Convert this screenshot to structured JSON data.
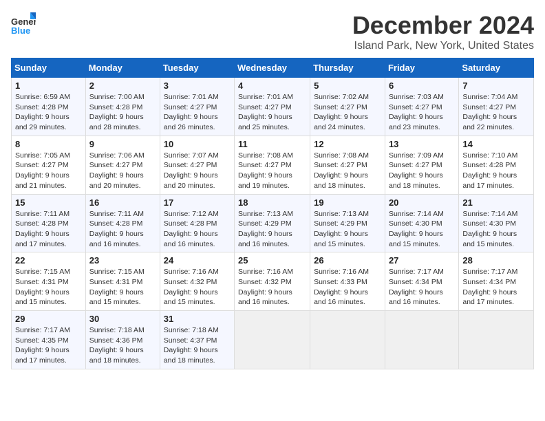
{
  "logo": {
    "line1": "General",
    "line2": "Blue"
  },
  "title": "December 2024",
  "subtitle": "Island Park, New York, United States",
  "days_of_week": [
    "Sunday",
    "Monday",
    "Tuesday",
    "Wednesday",
    "Thursday",
    "Friday",
    "Saturday"
  ],
  "weeks": [
    [
      {
        "day": 1,
        "info": "Sunrise: 6:59 AM\nSunset: 4:28 PM\nDaylight: 9 hours\nand 29 minutes."
      },
      {
        "day": 2,
        "info": "Sunrise: 7:00 AM\nSunset: 4:28 PM\nDaylight: 9 hours\nand 28 minutes."
      },
      {
        "day": 3,
        "info": "Sunrise: 7:01 AM\nSunset: 4:27 PM\nDaylight: 9 hours\nand 26 minutes."
      },
      {
        "day": 4,
        "info": "Sunrise: 7:01 AM\nSunset: 4:27 PM\nDaylight: 9 hours\nand 25 minutes."
      },
      {
        "day": 5,
        "info": "Sunrise: 7:02 AM\nSunset: 4:27 PM\nDaylight: 9 hours\nand 24 minutes."
      },
      {
        "day": 6,
        "info": "Sunrise: 7:03 AM\nSunset: 4:27 PM\nDaylight: 9 hours\nand 23 minutes."
      },
      {
        "day": 7,
        "info": "Sunrise: 7:04 AM\nSunset: 4:27 PM\nDaylight: 9 hours\nand 22 minutes."
      }
    ],
    [
      {
        "day": 8,
        "info": "Sunrise: 7:05 AM\nSunset: 4:27 PM\nDaylight: 9 hours\nand 21 minutes."
      },
      {
        "day": 9,
        "info": "Sunrise: 7:06 AM\nSunset: 4:27 PM\nDaylight: 9 hours\nand 20 minutes."
      },
      {
        "day": 10,
        "info": "Sunrise: 7:07 AM\nSunset: 4:27 PM\nDaylight: 9 hours\nand 20 minutes."
      },
      {
        "day": 11,
        "info": "Sunrise: 7:08 AM\nSunset: 4:27 PM\nDaylight: 9 hours\nand 19 minutes."
      },
      {
        "day": 12,
        "info": "Sunrise: 7:08 AM\nSunset: 4:27 PM\nDaylight: 9 hours\nand 18 minutes."
      },
      {
        "day": 13,
        "info": "Sunrise: 7:09 AM\nSunset: 4:27 PM\nDaylight: 9 hours\nand 18 minutes."
      },
      {
        "day": 14,
        "info": "Sunrise: 7:10 AM\nSunset: 4:28 PM\nDaylight: 9 hours\nand 17 minutes."
      }
    ],
    [
      {
        "day": 15,
        "info": "Sunrise: 7:11 AM\nSunset: 4:28 PM\nDaylight: 9 hours\nand 17 minutes."
      },
      {
        "day": 16,
        "info": "Sunrise: 7:11 AM\nSunset: 4:28 PM\nDaylight: 9 hours\nand 16 minutes."
      },
      {
        "day": 17,
        "info": "Sunrise: 7:12 AM\nSunset: 4:28 PM\nDaylight: 9 hours\nand 16 minutes."
      },
      {
        "day": 18,
        "info": "Sunrise: 7:13 AM\nSunset: 4:29 PM\nDaylight: 9 hours\nand 16 minutes."
      },
      {
        "day": 19,
        "info": "Sunrise: 7:13 AM\nSunset: 4:29 PM\nDaylight: 9 hours\nand 15 minutes."
      },
      {
        "day": 20,
        "info": "Sunrise: 7:14 AM\nSunset: 4:30 PM\nDaylight: 9 hours\nand 15 minutes."
      },
      {
        "day": 21,
        "info": "Sunrise: 7:14 AM\nSunset: 4:30 PM\nDaylight: 9 hours\nand 15 minutes."
      }
    ],
    [
      {
        "day": 22,
        "info": "Sunrise: 7:15 AM\nSunset: 4:31 PM\nDaylight: 9 hours\nand 15 minutes."
      },
      {
        "day": 23,
        "info": "Sunrise: 7:15 AM\nSunset: 4:31 PM\nDaylight: 9 hours\nand 15 minutes."
      },
      {
        "day": 24,
        "info": "Sunrise: 7:16 AM\nSunset: 4:32 PM\nDaylight: 9 hours\nand 15 minutes."
      },
      {
        "day": 25,
        "info": "Sunrise: 7:16 AM\nSunset: 4:32 PM\nDaylight: 9 hours\nand 16 minutes."
      },
      {
        "day": 26,
        "info": "Sunrise: 7:16 AM\nSunset: 4:33 PM\nDaylight: 9 hours\nand 16 minutes."
      },
      {
        "day": 27,
        "info": "Sunrise: 7:17 AM\nSunset: 4:34 PM\nDaylight: 9 hours\nand 16 minutes."
      },
      {
        "day": 28,
        "info": "Sunrise: 7:17 AM\nSunset: 4:34 PM\nDaylight: 9 hours\nand 17 minutes."
      }
    ],
    [
      {
        "day": 29,
        "info": "Sunrise: 7:17 AM\nSunset: 4:35 PM\nDaylight: 9 hours\nand 17 minutes."
      },
      {
        "day": 30,
        "info": "Sunrise: 7:18 AM\nSunset: 4:36 PM\nDaylight: 9 hours\nand 18 minutes."
      },
      {
        "day": 31,
        "info": "Sunrise: 7:18 AM\nSunset: 4:37 PM\nDaylight: 9 hours\nand 18 minutes."
      },
      null,
      null,
      null,
      null
    ]
  ]
}
